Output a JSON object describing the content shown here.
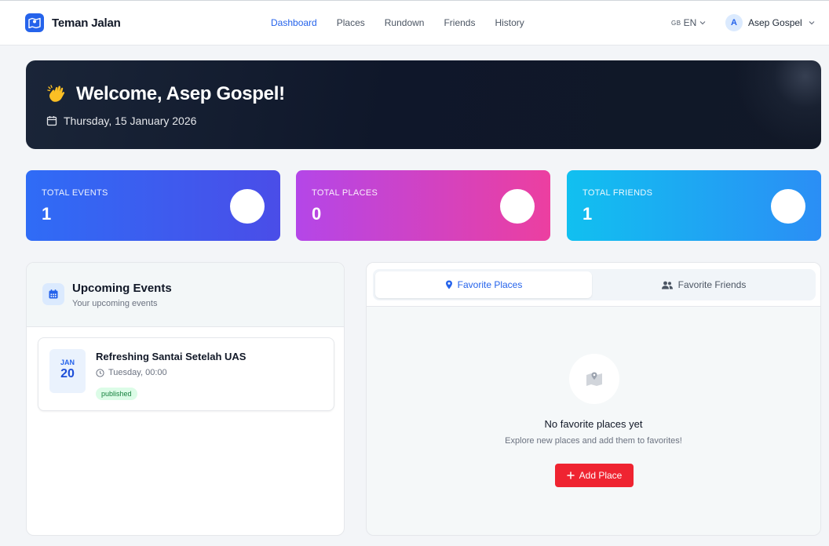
{
  "app": {
    "name": "Teman Jalan",
    "logo_icon": "map-pin-icon"
  },
  "nav": {
    "links": [
      "Dashboard",
      "Places",
      "Rundown",
      "Friends",
      "History"
    ],
    "active": "Dashboard",
    "lang_flag": "GB",
    "lang_code": "EN",
    "user_initial": "A",
    "user_name": "Asep Gospel"
  },
  "welcome": {
    "title": "Welcome, Asep Gospel!",
    "date": "Thursday, 15 January 2026"
  },
  "stats": [
    {
      "label": "TOTAL EVENTS",
      "value": "1",
      "colors": [
        "#2f6cf6",
        "#4a4de8"
      ]
    },
    {
      "label": "TOTAL PLACES",
      "value": "0",
      "colors": [
        "#b446e8",
        "#ec3fa0"
      ]
    },
    {
      "label": "TOTAL FRIENDS",
      "value": "1",
      "colors": [
        "#11c0f0",
        "#2b8ef5"
      ]
    }
  ],
  "upcoming": {
    "title": "Upcoming Events",
    "subtitle": "Your upcoming events",
    "events": [
      {
        "month": "JAN",
        "day": "20",
        "title": "Refreshing Santai Setelah UAS",
        "time": "Tuesday, 00:00",
        "status": "published"
      }
    ]
  },
  "favorites": {
    "tabs": [
      "Favorite Places",
      "Favorite Friends"
    ],
    "active_tab": "Favorite Places",
    "empty_title": "No favorite places yet",
    "empty_subtitle": "Explore new places and add them to favorites!",
    "add_label": "Add Place"
  },
  "colors": {
    "accent": "#2563eb",
    "danger": "#ef2431",
    "banner": "#0f172a"
  }
}
